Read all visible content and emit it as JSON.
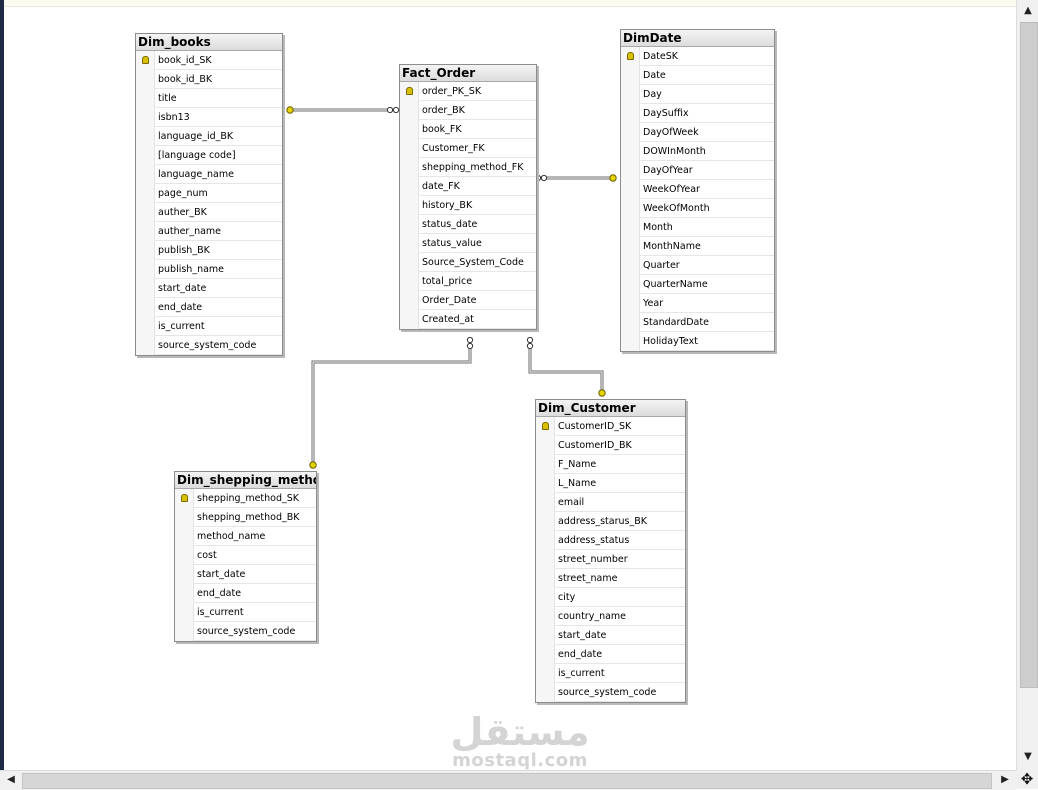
{
  "tables": {
    "dim_books": {
      "title": "Dim_books",
      "columns": [
        {
          "name": "book_id_SK",
          "pk": true
        },
        {
          "name": "book_id_BK"
        },
        {
          "name": "title"
        },
        {
          "name": "isbn13"
        },
        {
          "name": "language_id_BK"
        },
        {
          "name": "[language code]"
        },
        {
          "name": "language_name"
        },
        {
          "name": "page_num"
        },
        {
          "name": "auther_BK"
        },
        {
          "name": "auther_name"
        },
        {
          "name": "publish_BK"
        },
        {
          "name": "publish_name"
        },
        {
          "name": "start_date"
        },
        {
          "name": "end_date"
        },
        {
          "name": "is_current"
        },
        {
          "name": "source_system_code"
        }
      ]
    },
    "fact_order": {
      "title": "Fact_Order",
      "columns": [
        {
          "name": "order_PK_SK",
          "pk": true
        },
        {
          "name": "order_BK"
        },
        {
          "name": "book_FK"
        },
        {
          "name": "Customer_FK"
        },
        {
          "name": "shepping_method_FK"
        },
        {
          "name": "date_FK"
        },
        {
          "name": "history_BK"
        },
        {
          "name": "status_date"
        },
        {
          "name": "status_value"
        },
        {
          "name": "Source_System_Code"
        },
        {
          "name": "total_price"
        },
        {
          "name": "Order_Date"
        },
        {
          "name": "Created_at"
        }
      ]
    },
    "dim_date": {
      "title": "DimDate",
      "columns": [
        {
          "name": "DateSK",
          "pk": true
        },
        {
          "name": "Date"
        },
        {
          "name": "Day"
        },
        {
          "name": "DaySuffix"
        },
        {
          "name": "DayOfWeek"
        },
        {
          "name": "DOWInMonth"
        },
        {
          "name": "DayOfYear"
        },
        {
          "name": "WeekOfYear"
        },
        {
          "name": "WeekOfMonth"
        },
        {
          "name": "Month"
        },
        {
          "name": "MonthName"
        },
        {
          "name": "Quarter"
        },
        {
          "name": "QuarterName"
        },
        {
          "name": "Year"
        },
        {
          "name": "StandardDate"
        },
        {
          "name": "HolidayText"
        }
      ]
    },
    "dim_shepping_method": {
      "title": "Dim_shepping_method",
      "columns": [
        {
          "name": "shepping_method_SK",
          "pk": true
        },
        {
          "name": "shepping_method_BK"
        },
        {
          "name": "method_name"
        },
        {
          "name": "cost"
        },
        {
          "name": "start_date"
        },
        {
          "name": "end_date"
        },
        {
          "name": "is_current"
        },
        {
          "name": "source_system_code"
        }
      ]
    },
    "dim_customer": {
      "title": "Dim_Customer",
      "columns": [
        {
          "name": "CustomerID_SK",
          "pk": true
        },
        {
          "name": "CustomerID_BK"
        },
        {
          "name": "F_Name"
        },
        {
          "name": "L_Name"
        },
        {
          "name": "email"
        },
        {
          "name": "address_starus_BK"
        },
        {
          "name": "address_status"
        },
        {
          "name": "street_number"
        },
        {
          "name": "street_name"
        },
        {
          "name": "city"
        },
        {
          "name": "country_name"
        },
        {
          "name": "start_date"
        },
        {
          "name": "end_date"
        },
        {
          "name": "is_current"
        },
        {
          "name": "source_system_code"
        }
      ]
    }
  },
  "relationships": [
    {
      "from": "fact_order",
      "to": "dim_books"
    },
    {
      "from": "fact_order",
      "to": "dim_date"
    },
    {
      "from": "fact_order",
      "to": "dim_shepping_method"
    },
    {
      "from": "fact_order",
      "to": "dim_customer"
    }
  ],
  "watermark": {
    "arabic": "مستقل",
    "latin": "mostaql.com"
  },
  "icons": {
    "primary_key": "key-icon",
    "scroll_up": "▲",
    "scroll_down": "▼",
    "scroll_left": "◀",
    "scroll_right": "▶",
    "pan": "✥"
  }
}
